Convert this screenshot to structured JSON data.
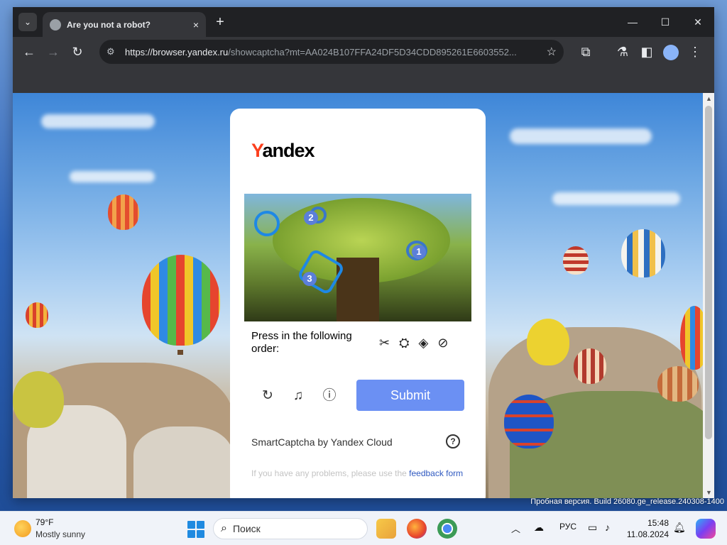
{
  "browser": {
    "tab_title": "Are you not a robot?",
    "tab_close": "×",
    "new_tab": "+",
    "url_host": "https://browser.yandex.ru",
    "url_path": "/showcaptcha?mt=AA024B107FFA24DF5D34CDD895261E6603552..."
  },
  "captcha": {
    "logo_y": "Y",
    "logo_rest": "andex",
    "numbers": [
      "1",
      "2",
      "3"
    ],
    "instruction": "Press in the following order:",
    "order_icons": "✂ ⛭ ◈ ⊘",
    "submit_label": "Submit",
    "brand": "SmartCaptcha by Yandex Cloud",
    "help_symbol": "?",
    "problems_text": "If you have any problems, please use the ",
    "feedback_link": "feedback form"
  },
  "desktop": {
    "watermark": "Пробная версия. Build 26080.ge_release.240308-1400"
  },
  "taskbar": {
    "temperature": "79°F",
    "condition": "Mostly sunny",
    "search_placeholder": "Поиск",
    "language": "РУС",
    "time": "15:48",
    "date": "11.08.2024"
  }
}
